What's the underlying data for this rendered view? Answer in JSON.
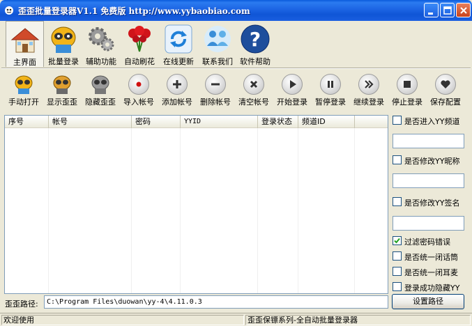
{
  "window": {
    "title": "歪歪批量登录器V1.1 免费版 http://www.yybaobiao.com"
  },
  "main_toolbar": {
    "items": [
      {
        "label": "主界面",
        "icon": "house-icon"
      },
      {
        "label": "批量登录",
        "icon": "yy-mascot-icon"
      },
      {
        "label": "辅助功能",
        "icon": "gears-icon"
      },
      {
        "label": "自动刷花",
        "icon": "roses-icon"
      },
      {
        "label": "在线更新",
        "icon": "refresh-icon"
      },
      {
        "label": "联系我们",
        "icon": "contacts-icon"
      },
      {
        "label": "软件帮助",
        "icon": "help-icon"
      }
    ]
  },
  "sub_toolbar": {
    "items": [
      {
        "label": "手动打开",
        "icon": "mascot-gold-icon"
      },
      {
        "label": "显示歪歪",
        "icon": "mascot-show-icon"
      },
      {
        "label": "隐藏歪歪",
        "icon": "mascot-hide-icon"
      },
      {
        "label": "导入帐号",
        "icon": "record-icon"
      },
      {
        "label": "添加帐号",
        "icon": "plus-icon"
      },
      {
        "label": "删除帐号",
        "icon": "minus-icon"
      },
      {
        "label": "清空帐号",
        "icon": "x-icon"
      },
      {
        "label": "开始登录",
        "icon": "play-icon"
      },
      {
        "label": "暂停登录",
        "icon": "pause-icon"
      },
      {
        "label": "继续登录",
        "icon": "forward-icon"
      },
      {
        "label": "停止登录",
        "icon": "stop-icon"
      },
      {
        "label": "保存配置",
        "icon": "heart-icon"
      }
    ]
  },
  "table": {
    "columns": [
      "序号",
      "帐号",
      "密码",
      "YYID",
      "登录状态",
      "频道ID"
    ],
    "rows": []
  },
  "right_panel": {
    "enter_channel": {
      "label": "是否进入YY频道",
      "checked": false,
      "value": ""
    },
    "modify_nickname": {
      "label": "是否修改YY昵称",
      "checked": false,
      "value": ""
    },
    "modify_signature": {
      "label": "是否修改YY签名",
      "checked": false,
      "value": ""
    },
    "filter_password_error": {
      "label": "过滤密码错误",
      "checked": true
    },
    "close_speaker": {
      "label": "是否统一闭话筒",
      "checked": false
    },
    "close_mic": {
      "label": "是否统一闭耳麦",
      "checked": false
    },
    "hide_on_success": {
      "label": "登录成功隐藏YY",
      "checked": false
    }
  },
  "path": {
    "label": "歪歪路径:",
    "value": "C:\\Program Files\\duowan\\yy-4\\4.11.0.3",
    "set_button": "设置路径"
  },
  "status_bar": {
    "left": "欢迎使用",
    "right": "歪歪保镖系列-全自动批量登录器"
  },
  "colors": {
    "titlebar": "#0F55D6",
    "window_bg": "#ECE9D8",
    "close_button": "#C9431C"
  }
}
